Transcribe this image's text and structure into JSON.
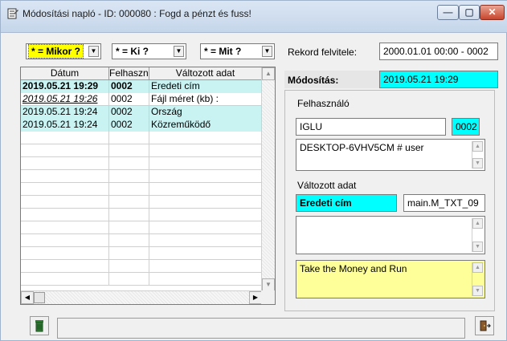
{
  "window": {
    "title": "Módosítási napló - ID: 000080 : Fogd a pénzt és fuss!",
    "min_glyph": "—",
    "max_glyph": "▢",
    "close_glyph": "✕"
  },
  "filters": [
    {
      "value": "* = Mikor ?"
    },
    {
      "value": "* = Ki ?"
    },
    {
      "value": "* = Mit ?"
    }
  ],
  "grid": {
    "columns": [
      "Dátum",
      "Felhasználó",
      "Változott adat"
    ],
    "rows": [
      {
        "date": "2019.05.21 19:29",
        "user": "0002",
        "field": "Eredeti cím"
      },
      {
        "date": "2019.05.21 19:26",
        "user": "0002",
        "field": "Fájl méret (kb) :"
      },
      {
        "date": "2019.05.21 19:24",
        "user": "0002",
        "field": "Ország"
      },
      {
        "date": "2019.05.21 19:24",
        "user": "0002",
        "field": "Közreműködő"
      }
    ]
  },
  "record": {
    "created_label": "Rekord felvitele:",
    "created_value": "2000.01.01 00:00 - 0002",
    "modified_label": "Módosítás:",
    "modified_value": "2019.05.21 19:29"
  },
  "user_section": {
    "label": "Felhasználó",
    "name": "IGLU",
    "id": "0002",
    "machine": "DESKTOP-6VHV5CM # user"
  },
  "changed_section": {
    "label": "Változott adat",
    "field_name": "Eredeti cím",
    "field_code": "main.M_TXT_09",
    "old_value": "",
    "new_value": "Take the Money and Run"
  },
  "colors": {
    "highlight_cyan": "#00ffff",
    "row_highlight": "#c9f2f2",
    "new_value_bg": "#ffff99",
    "active_filter": "#ffff00"
  }
}
